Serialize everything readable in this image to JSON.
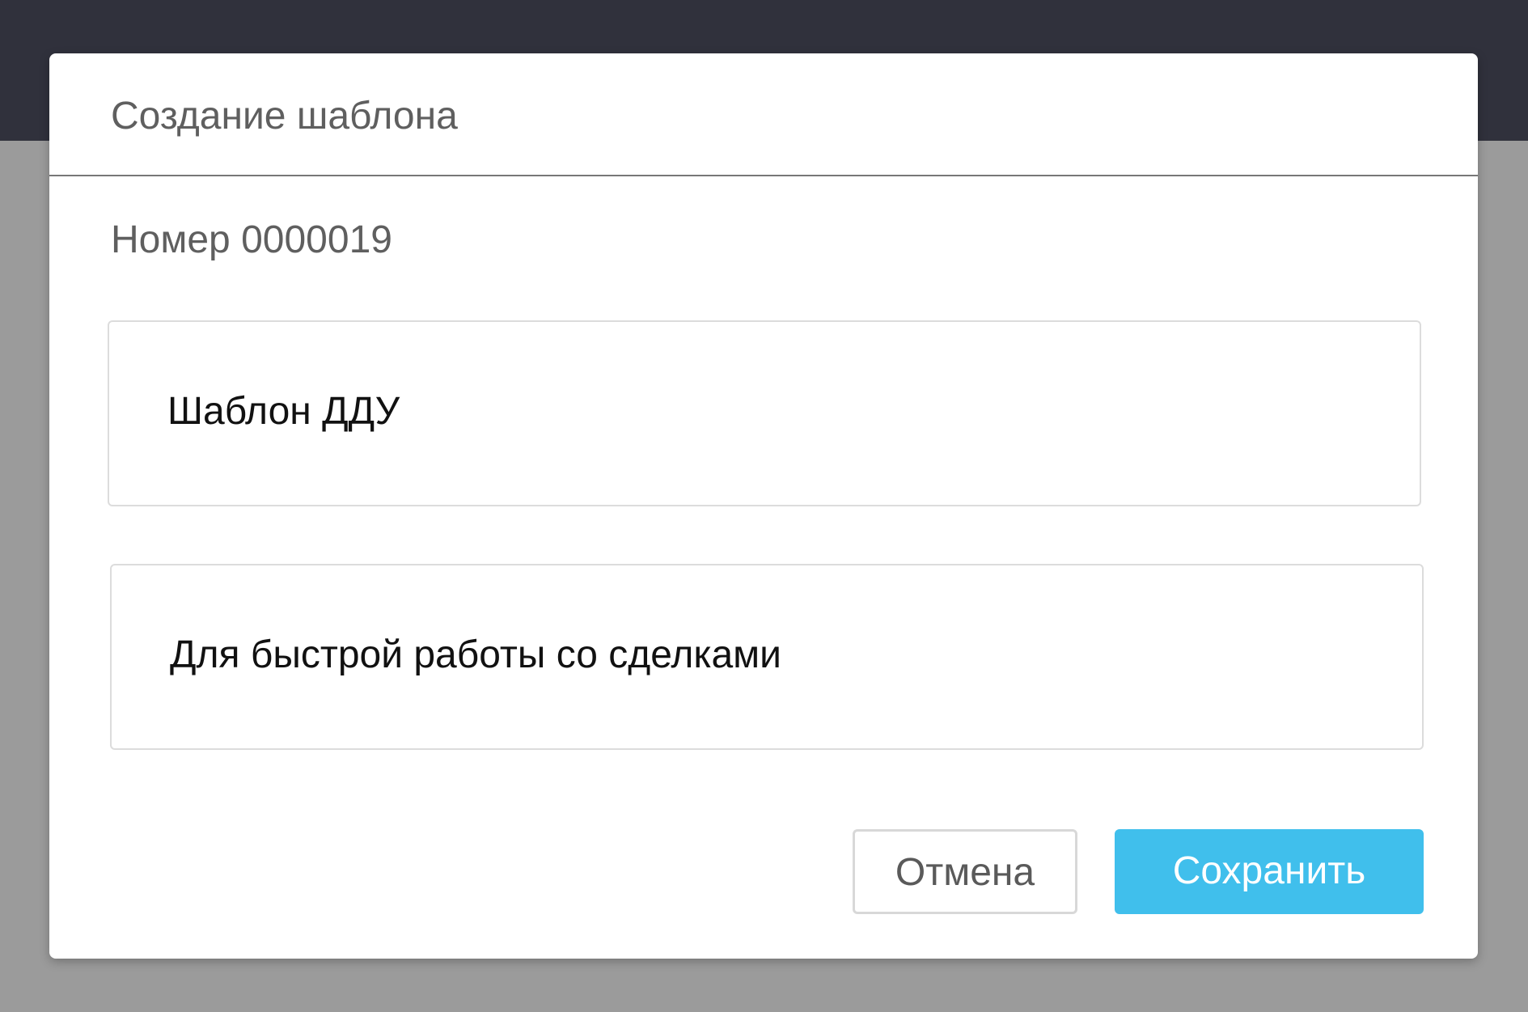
{
  "dialog": {
    "title": "Создание шаблона",
    "number_label": "Номер 0000019"
  },
  "form": {
    "name_value": "Шаблон ДДУ",
    "description_value": "Для быстрой работы со сделками"
  },
  "actions": {
    "cancel_label": "Отмена",
    "save_label": "Сохранить"
  },
  "colors": {
    "topbar": "#30313c",
    "overlay": "#9b9b9b",
    "primary_button": "#40bfec"
  }
}
